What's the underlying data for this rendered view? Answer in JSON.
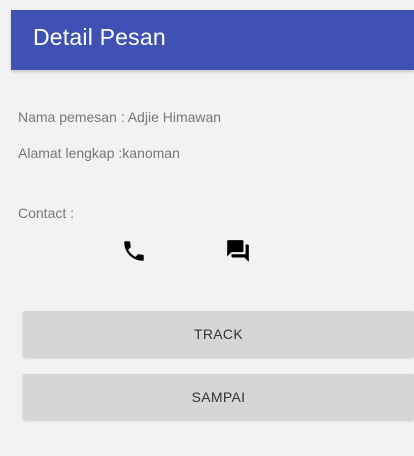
{
  "appbar": {
    "title": "Detail Pesan",
    "color": "#3f51b5"
  },
  "order": {
    "name_line": "Nama pemesan : Adjie Himawan",
    "address_line": "Alamat lengkap :kanoman",
    "contact_label": "Contact :"
  },
  "contact_icons": {
    "call": "phone-icon",
    "message": "chat-icon"
  },
  "buttons": {
    "track_label": "TRACK",
    "done_label": "SAMPAI"
  }
}
